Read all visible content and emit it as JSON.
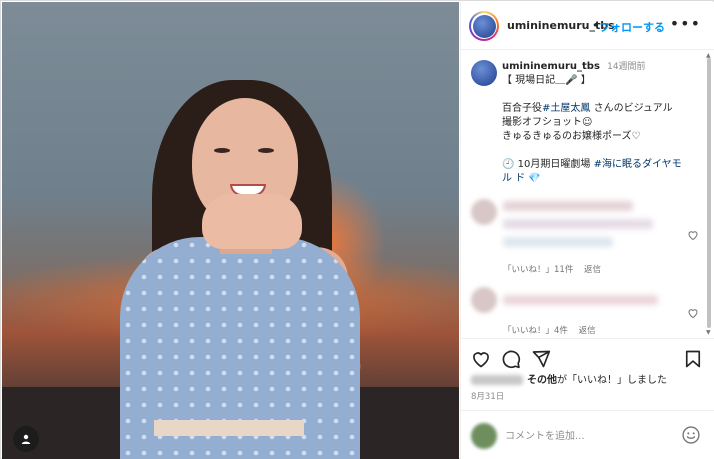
{
  "header": {
    "username": "umininemuru_tbs",
    "separator": "•",
    "follow_label": "フォローする",
    "more_icon": "more-horizontal-icon"
  },
  "caption": {
    "username": "umininemuru_tbs",
    "time": "14週間前",
    "lines": [
      "【 現場日記＿🎤 】",
      "",
      "百合子役",
      "さんのビジュアル",
      "撮影オフショット☺︎",
      "きゅるきゅるのお嬢様ポーズ♡",
      "",
      "10月期日曜劇場",
      "ル ド"
    ],
    "tag_actor": "#土屋太鳳",
    "tag_show": "#海に眠るダイヤモ",
    "clock_icon": "clock-emoji-icon",
    "gem_icon": "gem-emoji-icon"
  },
  "comments": [
    {
      "likes": "「いいね！」11件",
      "reply": "返信"
    },
    {
      "likes": "「いいね！」4件",
      "reply": "返信"
    }
  ],
  "likes": {
    "others": "その他",
    "suffix": "が「いいね！」しました"
  },
  "date": "8月31日",
  "comment_box": {
    "placeholder": "コメントを追加..."
  },
  "colors": {
    "accent": "#0095f6",
    "hashtag": "#00376b",
    "muted": "#8e8e8e"
  }
}
